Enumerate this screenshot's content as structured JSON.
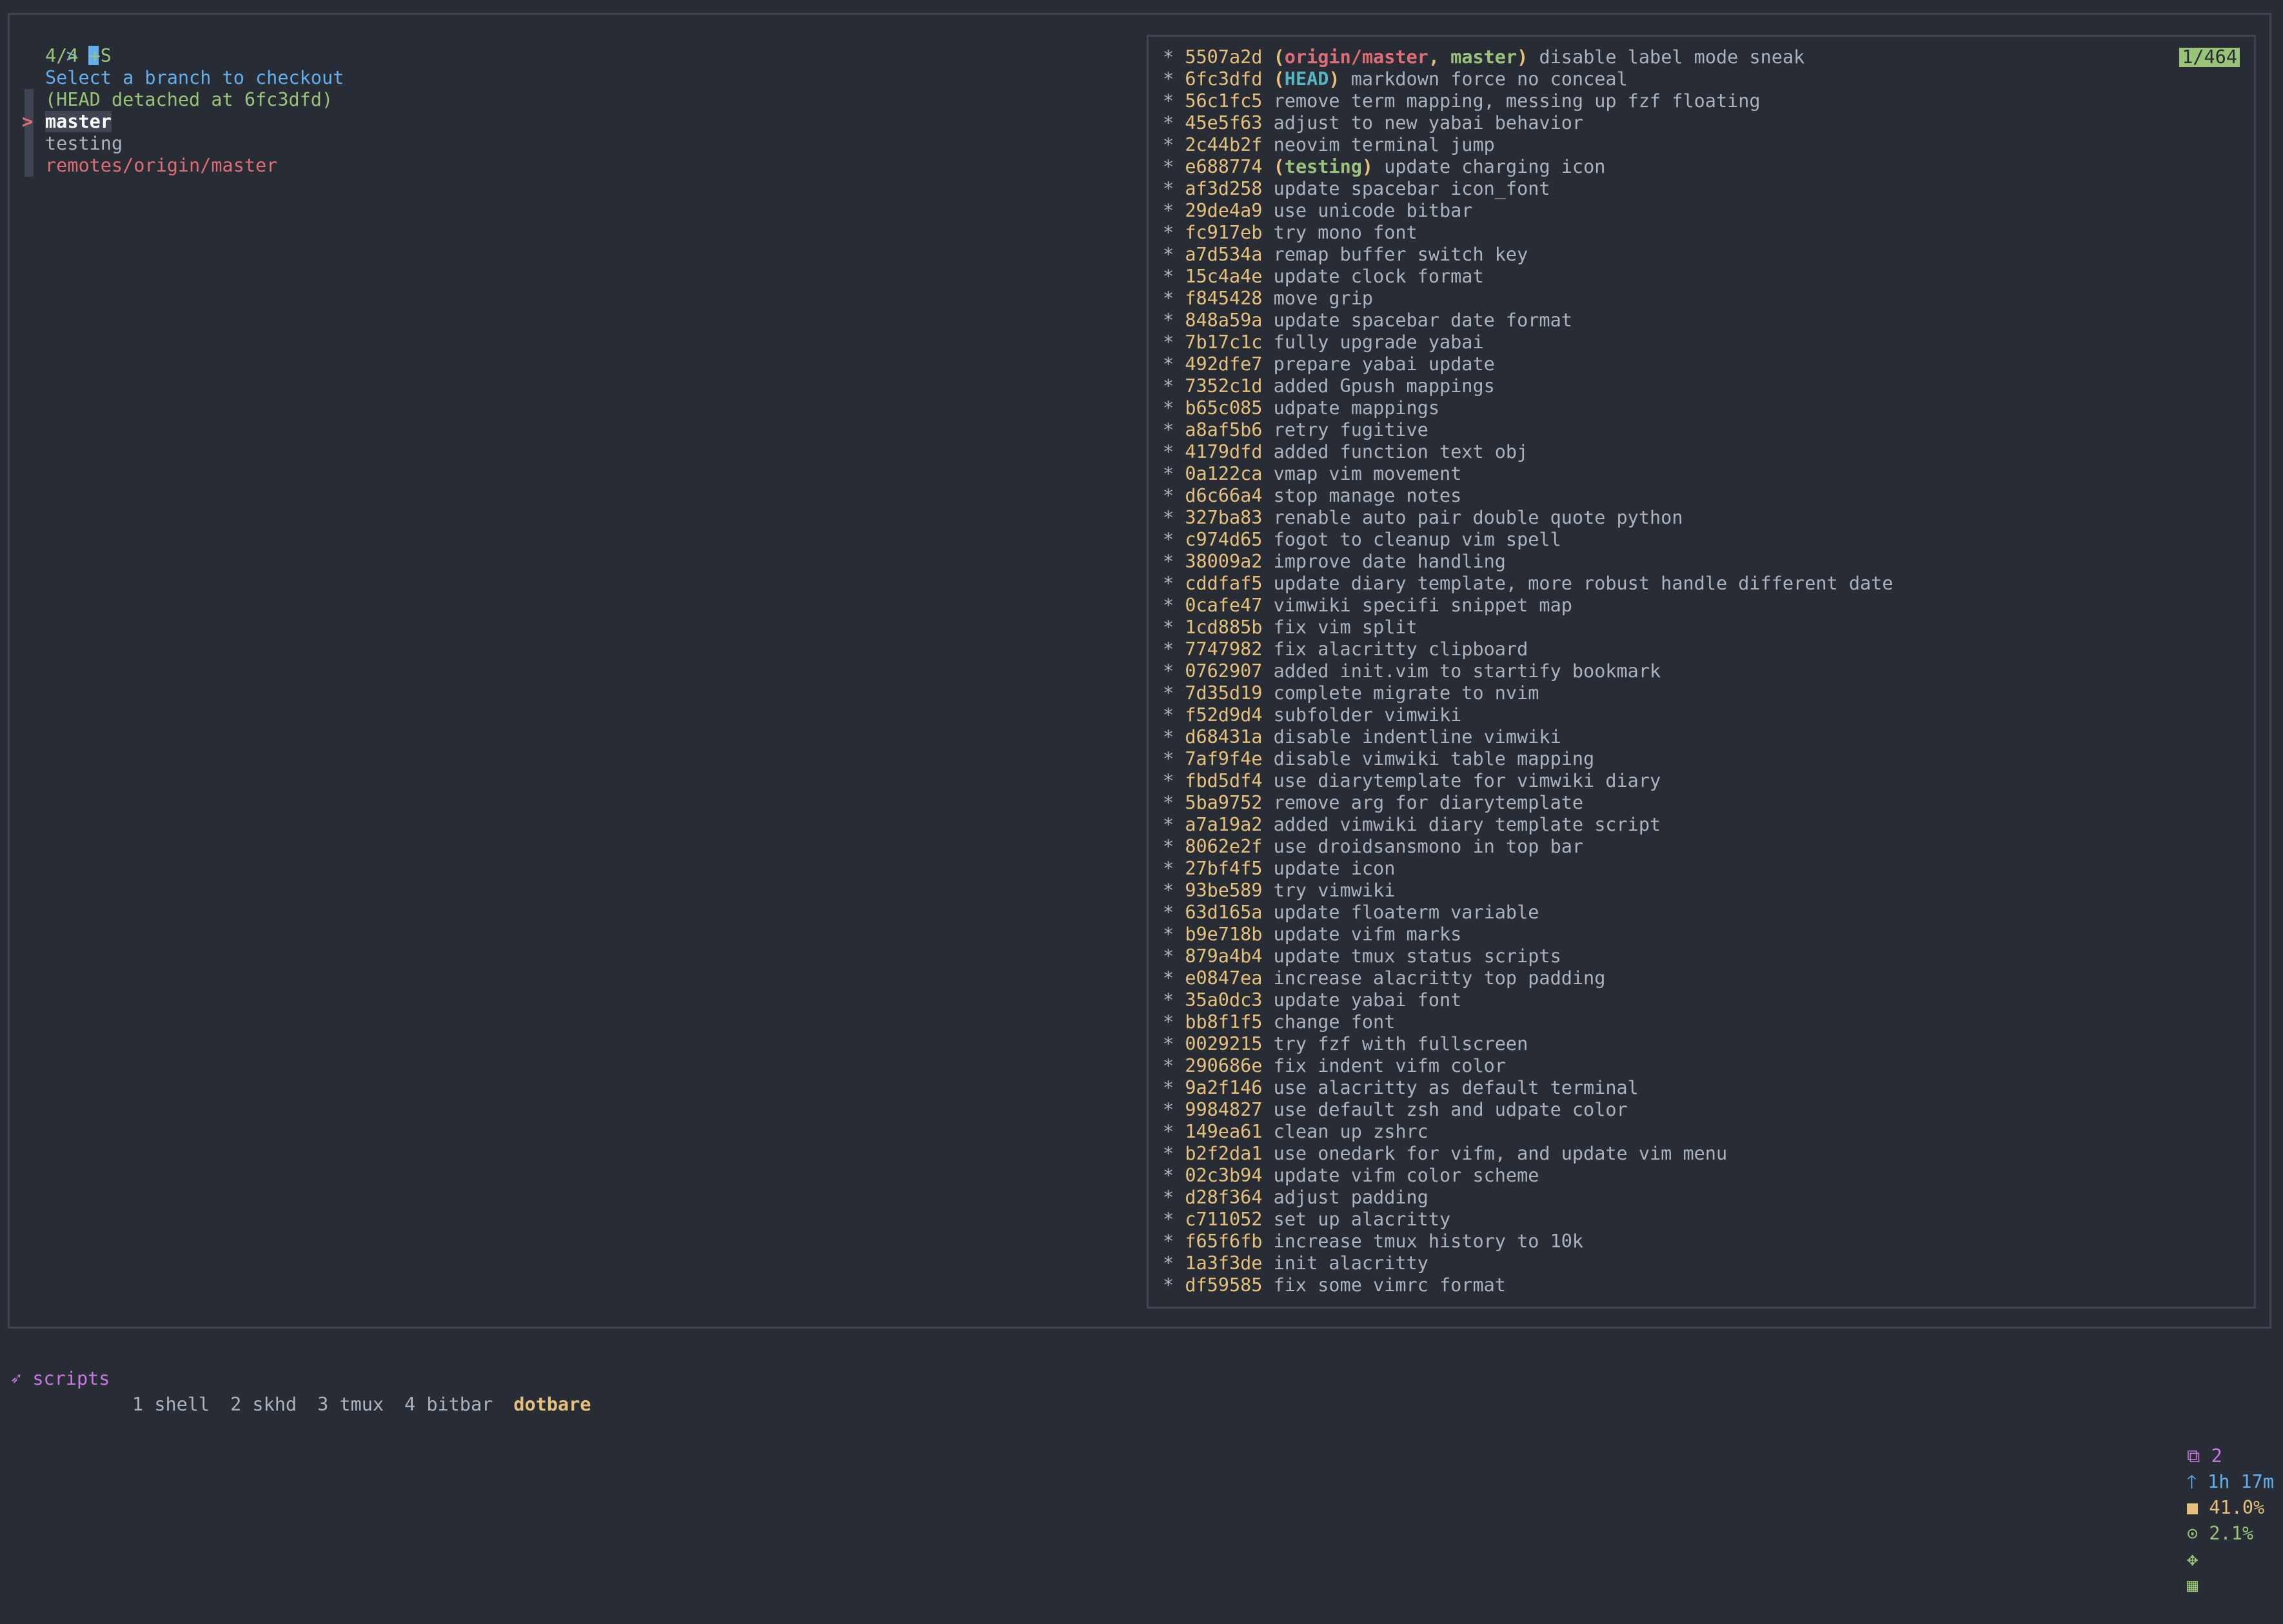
{
  "fzf": {
    "prompt": ">",
    "count": "4/4 +S",
    "header": "Select a branch to checkout",
    "branches": [
      {
        "label": "(HEAD detached at 6fc3dfd)",
        "style": "head",
        "current": false
      },
      {
        "label": "master",
        "style": "current",
        "current": true
      },
      {
        "label": "testing",
        "style": "plain",
        "current": false
      },
      {
        "label": "remotes/origin/master",
        "style": "remote",
        "current": false
      }
    ],
    "pointer": ">"
  },
  "preview": {
    "counter": "1/464",
    "commits": [
      {
        "hash": "5507a2d",
        "refs": [
          {
            "name": "origin/master",
            "kind": "remote"
          },
          {
            "name": "master",
            "kind": "local"
          }
        ],
        "msg": "disable label mode sneak"
      },
      {
        "hash": "6fc3dfd",
        "refs": [
          {
            "name": "HEAD",
            "kind": "head"
          }
        ],
        "msg": "markdown force no conceal"
      },
      {
        "hash": "56c1fc5",
        "refs": [],
        "msg": "remove term mapping, messing up fzf floating"
      },
      {
        "hash": "45e5f63",
        "refs": [],
        "msg": "adjust to new yabai behavior"
      },
      {
        "hash": "2c44b2f",
        "refs": [],
        "msg": "neovim terminal jump"
      },
      {
        "hash": "e688774",
        "refs": [
          {
            "name": "testing",
            "kind": "local"
          }
        ],
        "msg": "update charging icon"
      },
      {
        "hash": "af3d258",
        "refs": [],
        "msg": "update spacebar icon_font"
      },
      {
        "hash": "29de4a9",
        "refs": [],
        "msg": "use unicode bitbar"
      },
      {
        "hash": "fc917eb",
        "refs": [],
        "msg": "try mono font"
      },
      {
        "hash": "a7d534a",
        "refs": [],
        "msg": "remap buffer switch key"
      },
      {
        "hash": "15c4a4e",
        "refs": [],
        "msg": "update clock format"
      },
      {
        "hash": "f845428",
        "refs": [],
        "msg": "move grip"
      },
      {
        "hash": "848a59a",
        "refs": [],
        "msg": "update spacebar date format"
      },
      {
        "hash": "7b17c1c",
        "refs": [],
        "msg": "fully upgrade yabai"
      },
      {
        "hash": "492dfe7",
        "refs": [],
        "msg": "prepare yabai update"
      },
      {
        "hash": "7352c1d",
        "refs": [],
        "msg": "added Gpush mappings"
      },
      {
        "hash": "b65c085",
        "refs": [],
        "msg": "udpate mappings"
      },
      {
        "hash": "a8af5b6",
        "refs": [],
        "msg": "retry fugitive"
      },
      {
        "hash": "4179dfd",
        "refs": [],
        "msg": "added function text obj"
      },
      {
        "hash": "0a122ca",
        "refs": [],
        "msg": "vmap vim movement"
      },
      {
        "hash": "d6c66a4",
        "refs": [],
        "msg": "stop manage notes"
      },
      {
        "hash": "327ba83",
        "refs": [],
        "msg": "renable auto pair double quote python"
      },
      {
        "hash": "c974d65",
        "refs": [],
        "msg": "fogot to cleanup vim spell"
      },
      {
        "hash": "38009a2",
        "refs": [],
        "msg": "improve date handling"
      },
      {
        "hash": "cddfaf5",
        "refs": [],
        "msg": "update diary template, more robust handle different date"
      },
      {
        "hash": "0cafe47",
        "refs": [],
        "msg": "vimwiki specifi snippet map"
      },
      {
        "hash": "1cd885b",
        "refs": [],
        "msg": "fix vim split"
      },
      {
        "hash": "7747982",
        "refs": [],
        "msg": "fix alacritty clipboard"
      },
      {
        "hash": "0762907",
        "refs": [],
        "msg": "added init.vim to startify bookmark"
      },
      {
        "hash": "7d35d19",
        "refs": [],
        "msg": "complete migrate to nvim"
      },
      {
        "hash": "f52d9d4",
        "refs": [],
        "msg": "subfolder vimwiki"
      },
      {
        "hash": "d68431a",
        "refs": [],
        "msg": "disable indentline vimwiki"
      },
      {
        "hash": "7af9f4e",
        "refs": [],
        "msg": "disable vimwiki table mapping"
      },
      {
        "hash": "fbd5df4",
        "refs": [],
        "msg": "use diarytemplate for vimwiki diary"
      },
      {
        "hash": "5ba9752",
        "refs": [],
        "msg": "remove arg for diarytemplate"
      },
      {
        "hash": "a7a19a2",
        "refs": [],
        "msg": "added vimwiki diary template script"
      },
      {
        "hash": "8062e2f",
        "refs": [],
        "msg": "use droidsansmono in top bar"
      },
      {
        "hash": "27bf4f5",
        "refs": [],
        "msg": "update icon"
      },
      {
        "hash": "93be589",
        "refs": [],
        "msg": "try vimwiki"
      },
      {
        "hash": "63d165a",
        "refs": [],
        "msg": "update floaterm variable"
      },
      {
        "hash": "b9e718b",
        "refs": [],
        "msg": "update vifm marks"
      },
      {
        "hash": "879a4b4",
        "refs": [],
        "msg": "update tmux status scripts"
      },
      {
        "hash": "e0847ea",
        "refs": [],
        "msg": "increase alacritty top padding"
      },
      {
        "hash": "35a0dc3",
        "refs": [],
        "msg": "update yabai font"
      },
      {
        "hash": "bb8f1f5",
        "refs": [],
        "msg": "change font"
      },
      {
        "hash": "0029215",
        "refs": [],
        "msg": "try fzf with fullscreen"
      },
      {
        "hash": "290686e",
        "refs": [],
        "msg": "fix indent vifm color"
      },
      {
        "hash": "9a2f146",
        "refs": [],
        "msg": "use alacritty as default terminal"
      },
      {
        "hash": "9984827",
        "refs": [],
        "msg": "use default zsh and udpate color"
      },
      {
        "hash": "149ea61",
        "refs": [],
        "msg": "clean up zshrc"
      },
      {
        "hash": "b2f2da1",
        "refs": [],
        "msg": "use onedark for vifm, and update vim menu"
      },
      {
        "hash": "02c3b94",
        "refs": [],
        "msg": "update vifm color scheme"
      },
      {
        "hash": "d28f364",
        "refs": [],
        "msg": "adjust padding"
      },
      {
        "hash": "c711052",
        "refs": [],
        "msg": "set up alacritty"
      },
      {
        "hash": "f65f6fb",
        "refs": [],
        "msg": "increase tmux history to 10k"
      },
      {
        "hash": "1a3f3de",
        "refs": [],
        "msg": "init alacritty"
      },
      {
        "hash": "df59585",
        "refs": [],
        "msg": "fix some vimrc format"
      }
    ]
  },
  "tmux": {
    "session_icon": "➶",
    "session": "scripts",
    "windows": [
      {
        "label": "1 shell",
        "active": false
      },
      {
        "label": "2 skhd",
        "active": false
      },
      {
        "label": "3 tmux",
        "active": false
      },
      {
        "label": "4 bitbar",
        "active": false
      },
      {
        "label": "dotbare",
        "active": true
      }
    ],
    "panes": "2",
    "uptime": "1h 17m",
    "battery": "41.0%",
    "cpu": "2.1%"
  }
}
